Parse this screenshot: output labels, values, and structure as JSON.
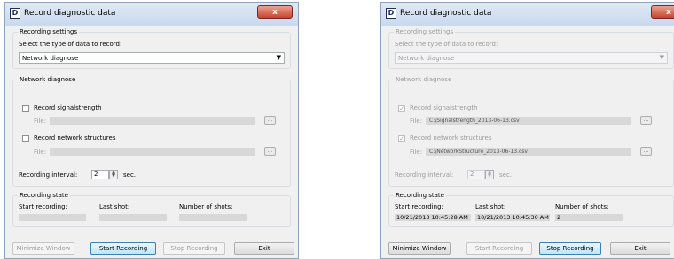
{
  "dialogs": [
    {
      "title": "Record diagnostic data",
      "close": "x",
      "recording_settings": {
        "legend": "Recording settings",
        "select_label": "Select the type of data to record:",
        "select_value": "Network diagnose",
        "arrow": "▼"
      },
      "network": {
        "legend": "Network diagnose",
        "signal": {
          "label": "Record signalstrength",
          "file_label": "File:",
          "file_value": "",
          "checked_mark": "",
          "browse": "..."
        },
        "structures": {
          "label": "Record network structures",
          "file_label": "File:",
          "file_value": "",
          "checked_mark": "",
          "browse": "..."
        },
        "interval_label": "Recording interval:",
        "interval_value": "2",
        "interval_unit": "sec."
      },
      "state": {
        "legend": "Recording state",
        "start_label": "Start recording:",
        "last_label": "Last shot:",
        "shots_label": "Number of shots:",
        "start_value": "",
        "last_value": "",
        "shots_value": ""
      },
      "buttons": {
        "minimize": "Minimize Window",
        "start": "Start Recording",
        "stop": "Stop Recording",
        "exit": "Exit"
      }
    },
    {
      "title": "Record diagnostic data",
      "close": "x",
      "recording_settings": {
        "legend": "Recording settings",
        "select_label": "Select the type of data to record:",
        "select_value": "Network diagnose",
        "arrow": "▼"
      },
      "network": {
        "legend": "Network diagnose",
        "signal": {
          "label": "Record signalstrength",
          "file_label": "File:",
          "file_value": "C:\\Signalstrength_2013-06-13.csv",
          "checked_mark": "✓",
          "browse": "..."
        },
        "structures": {
          "label": "Record network structures",
          "file_label": "File:",
          "file_value": "C:\\NetworkStructure_2013-06-13.csv",
          "checked_mark": "✓",
          "browse": "..."
        },
        "interval_label": "Recording interval:",
        "interval_value": "2",
        "interval_unit": "sec."
      },
      "state": {
        "legend": "Recording state",
        "start_label": "Start recording:",
        "last_label": "Last shot:",
        "shots_label": "Number of shots:",
        "start_value": "10/21/2013 10:45:28 AM",
        "last_value": "10/21/2013 10:45:30 AM",
        "shots_value": "2"
      },
      "buttons": {
        "minimize": "Minimize Window",
        "start": "Start Recording",
        "stop": "Stop Recording",
        "exit": "Exit"
      }
    }
  ]
}
